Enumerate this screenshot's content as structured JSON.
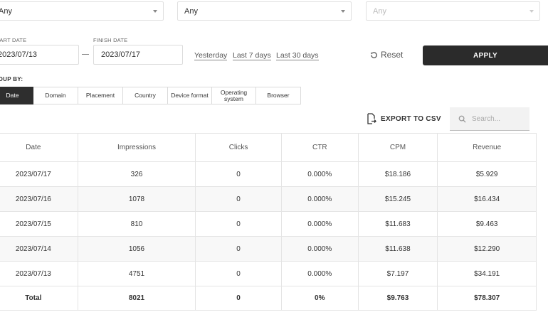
{
  "filters": [
    {
      "value": "Any",
      "disabled": false
    },
    {
      "value": "Any",
      "disabled": false
    },
    {
      "value": "Any",
      "disabled": true
    }
  ],
  "dates": {
    "start_label": "START DATE",
    "start_value": "2023/07/13",
    "finish_label": "FINISH DATE",
    "finish_value": "2023/07/17"
  },
  "quick_ranges": [
    "Yesterday",
    "Last 7 days",
    "Last 30 days"
  ],
  "actions": {
    "reset_label": "Reset",
    "apply_label": "APPLY"
  },
  "group_by": {
    "label": "GROUP BY:",
    "options": [
      {
        "label": "Date",
        "active": true
      },
      {
        "label": "Domain",
        "active": false
      },
      {
        "label": "Placement",
        "active": false
      },
      {
        "label": "Country",
        "active": false
      },
      {
        "label": "Device format",
        "active": false
      },
      {
        "label": "Operating system",
        "active": false
      },
      {
        "label": "Browser",
        "active": false
      }
    ]
  },
  "toolbar": {
    "export_label": "EXPORT TO CSV",
    "search_placeholder": "Search..."
  },
  "table": {
    "columns": [
      "Date",
      "Impressions",
      "Clicks",
      "CTR",
      "CPM",
      "Revenue"
    ],
    "rows": [
      [
        "2023/07/17",
        "326",
        "0",
        "0.000%",
        "$18.186",
        "$5.929"
      ],
      [
        "2023/07/16",
        "1078",
        "0",
        "0.000%",
        "$15.245",
        "$16.434"
      ],
      [
        "2023/07/15",
        "810",
        "0",
        "0.000%",
        "$11.683",
        "$9.463"
      ],
      [
        "2023/07/14",
        "1056",
        "0",
        "0.000%",
        "$11.638",
        "$12.290"
      ],
      [
        "2023/07/13",
        "4751",
        "0",
        "0.000%",
        "$7.197",
        "$34.191"
      ]
    ],
    "total": [
      "Total",
      "8021",
      "0",
      "0%",
      "$9.763",
      "$78.307"
    ]
  },
  "colors": {
    "primary_dark": "#2b2b2b",
    "border": "#e4e4e4",
    "search_bg": "#f2f2f2"
  }
}
